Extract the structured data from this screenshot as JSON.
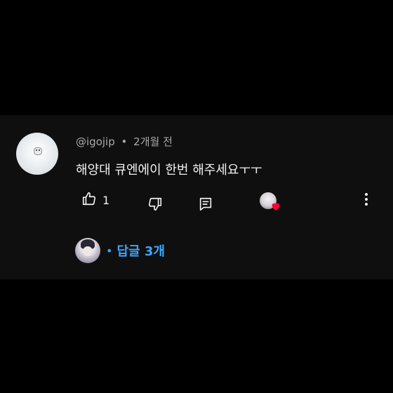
{
  "comment": {
    "author": "@igojip",
    "separator": "•",
    "time": "2개월 전",
    "text": "해양대 큐엔에이 한번 해주세요ㅜㅜ",
    "like_count": "1"
  },
  "actions": {
    "like_icon": "thumb-up-icon",
    "dislike_icon": "thumb-down-icon",
    "reply_icon": "reply-icon",
    "more_icon": "more-vert-icon",
    "creator_heart_icon": "heart-icon"
  },
  "replies": {
    "dot": "•",
    "label": "답글 3개"
  },
  "colors": {
    "background": "#000000",
    "card": "#0f0f0f",
    "text_primary": "#f1f1f1",
    "text_secondary": "#aaaaaa",
    "link_blue": "#3ea6ff",
    "heart_red": "#ff0033"
  }
}
